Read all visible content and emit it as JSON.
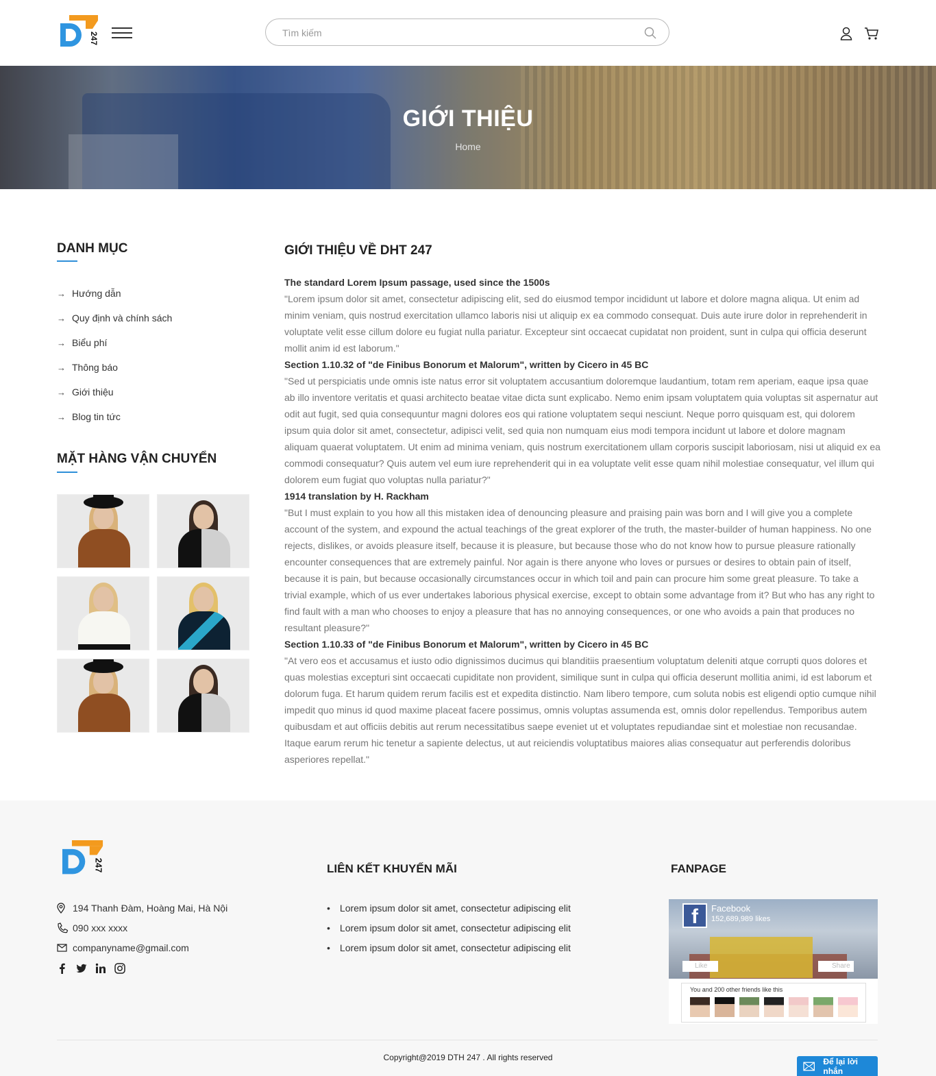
{
  "header": {
    "logo_text": "DT 247",
    "search_placeholder": "Tìm kiếm"
  },
  "banner": {
    "title": "GIỚI THIỆU",
    "breadcrumb": "Home"
  },
  "sidebar": {
    "categories_title": "DANH MỤC",
    "categories": [
      {
        "label": "Hướng dẫn"
      },
      {
        "label": "Quy định và chính sách"
      },
      {
        "label": "Biểu phí"
      },
      {
        "label": "Thông báo"
      },
      {
        "label": "Giới thiệu"
      },
      {
        "label": "Blog tin tức"
      }
    ],
    "products_title": "MẶT HÀNG VẬN CHUYỂN"
  },
  "main": {
    "title": "GIỚI THIỆU VỀ DHT 247",
    "sections": [
      {
        "heading": "The standard Lorem Ipsum passage, used since the 1500s",
        "body": "\"Lorem ipsum dolor sit amet, consectetur adipiscing elit, sed do eiusmod tempor incididunt ut labore et dolore magna aliqua. Ut enim ad minim veniam, quis nostrud exercitation ullamco laboris nisi ut aliquip ex ea commodo consequat. Duis aute irure dolor in reprehenderit in voluptate velit esse cillum dolore eu fugiat nulla pariatur. Excepteur sint occaecat cupidatat non proident, sunt in culpa qui officia deserunt mollit anim id est laborum.\""
      },
      {
        "heading": "Section 1.10.32 of \"de Finibus Bonorum et Malorum\", written by Cicero in 45 BC",
        "body": "\"Sed ut perspiciatis unde omnis iste natus error sit voluptatem accusantium doloremque laudantium, totam rem aperiam, eaque ipsa quae ab illo inventore veritatis et quasi architecto beatae vitae dicta sunt explicabo. Nemo enim ipsam voluptatem quia voluptas sit aspernatur aut odit aut fugit, sed quia consequuntur magni dolores eos qui ratione voluptatem sequi nesciunt. Neque porro quisquam est, qui dolorem ipsum quia dolor sit amet, consectetur, adipisci velit, sed quia non numquam eius modi tempora incidunt ut labore et dolore magnam aliquam quaerat voluptatem. Ut enim ad minima veniam, quis nostrum exercitationem ullam corporis suscipit laboriosam, nisi ut aliquid ex ea commodi consequatur? Quis autem vel eum iure reprehenderit qui in ea voluptate velit esse quam nihil molestiae consequatur, vel illum qui dolorem eum fugiat quo voluptas nulla pariatur?\""
      },
      {
        "heading": "1914 translation by H. Rackham",
        "body": "\"But I must explain to you how all this mistaken idea of denouncing pleasure and praising pain was born and I will give you a complete account of the system, and expound the actual teachings of the great explorer of the truth, the master-builder of human happiness. No one rejects, dislikes, or avoids pleasure itself, because it is pleasure, but because those who do not know how to pursue pleasure rationally encounter consequences that are extremely painful. Nor again is there anyone who loves or pursues or desires to obtain pain of itself, because it is pain, but because occasionally circumstances occur in which toil and pain can procure him some great pleasure. To take a trivial example, which of us ever undertakes laborious physical exercise, except to obtain some advantage from it? But who has any right to find fault with a man who chooses to enjoy a pleasure that has no annoying consequences, or one who avoids a pain that produces no resultant pleasure?\""
      },
      {
        "heading": "Section 1.10.33 of \"de Finibus Bonorum et Malorum\", written by Cicero in 45 BC",
        "body": "\"At vero eos et accusamus et iusto odio dignissimos ducimus qui blanditiis praesentium voluptatum deleniti atque corrupti quos dolores et quas molestias excepturi sint occaecati cupiditate non provident, similique sunt in culpa qui officia deserunt mollitia animi, id est laborum et dolorum fuga. Et harum quidem rerum facilis est et expedita distinctio. Nam libero tempore, cum soluta nobis est eligendi optio cumque nihil impedit quo minus id quod maxime placeat facere possimus, omnis voluptas assumenda est, omnis dolor repellendus. Temporibus autem quibusdam et aut officiis debitis aut rerum necessitatibus saepe eveniet ut et voluptates repudiandae sint et molestiae non recusandae. Itaque earum rerum hic tenetur a sapiente delectus, ut aut reiciendis voluptatibus maiores alias consequatur aut perferendis doloribus asperiores repellat.\""
      }
    ]
  },
  "footer": {
    "address": "194 Thanh Đàm, Hoàng Mai, Hà Nội",
    "phone": "090 xxx xxxx",
    "email": "companyname@gmail.com",
    "promo_title": "LIÊN KẾT KHUYẾN MÃI",
    "promo_links": [
      {
        "label": "Lorem ipsum dolor sit amet, consectetur adipiscing elit"
      },
      {
        "label": "Lorem ipsum dolor sit amet, consectetur adipiscing elit"
      },
      {
        "label": "Lorem ipsum dolor sit amet, consectetur adipiscing elit"
      }
    ],
    "fanpage_title": "FANPAGE",
    "fanpage": {
      "name": "Facebook",
      "likes": "152,689,989 likes",
      "like_label": "Like",
      "share_label": "Share",
      "friends_text": "You and 200 other friends like this"
    },
    "copyright": "Copyright@2019 DTH 247 . All rights reserved",
    "message_button": "Để lại lời nhắn"
  },
  "colors": {
    "accent": "#2e8fd8",
    "logo_orange": "#f39a1e",
    "logo_blue": "#2f95e0"
  }
}
